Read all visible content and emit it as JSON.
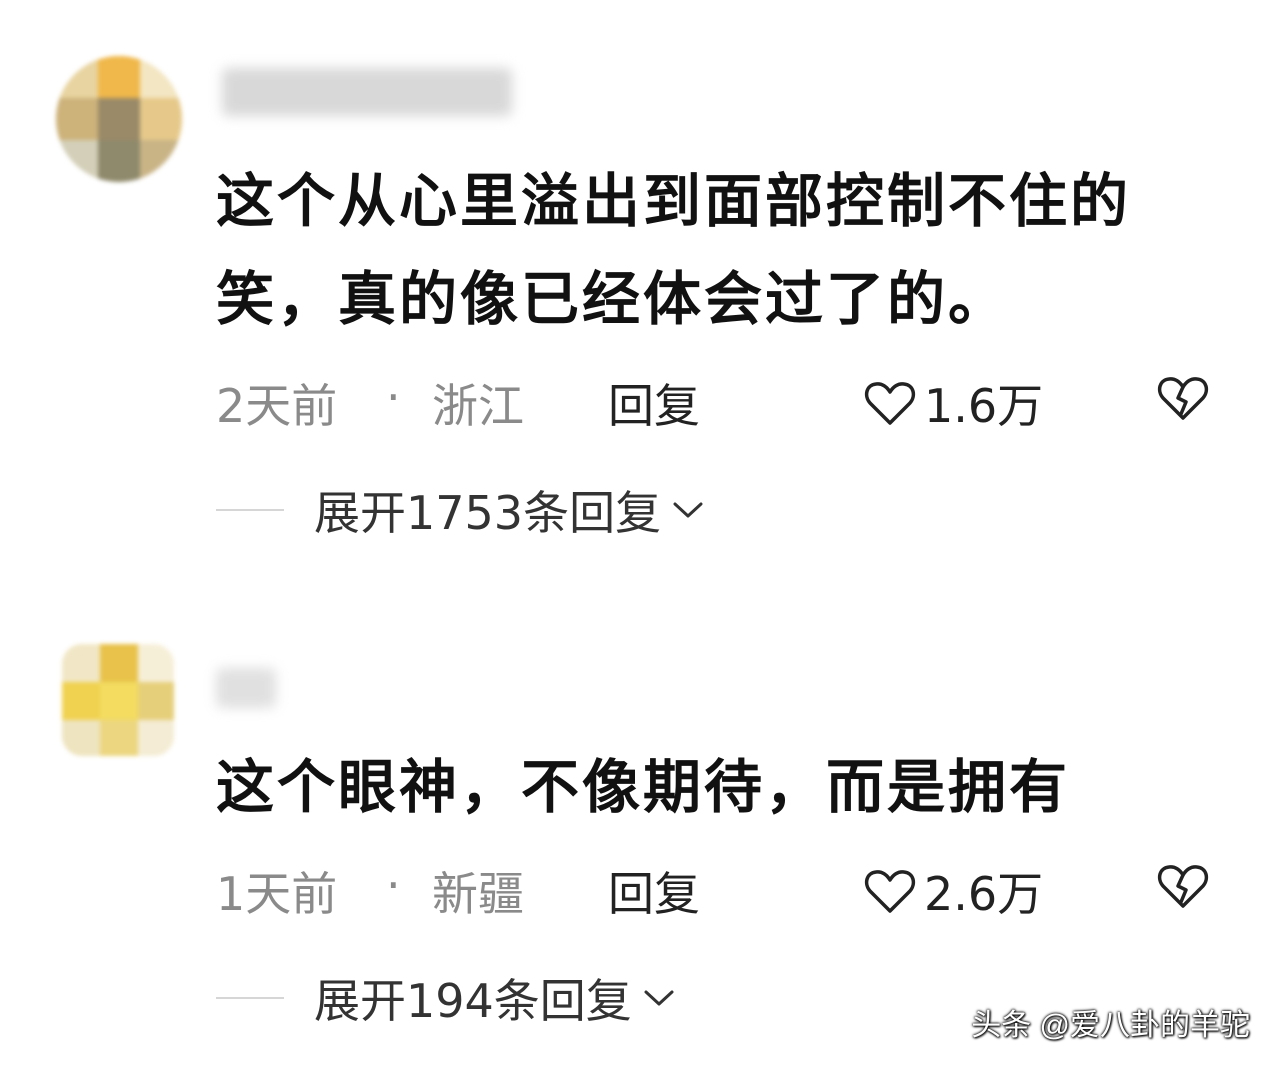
{
  "comments": [
    {
      "text": "这个从心里溢出到面部控制不住的笑，真的像已经体会过了的。",
      "time": "2天前",
      "separator": "·",
      "location": "浙江",
      "reply_label": "回复",
      "likes": "1.6万",
      "expand_label": "展开1753条回复"
    },
    {
      "text": "这个眼神，不像期待，而是拥有",
      "time": "1天前",
      "separator": "·",
      "location": "新疆",
      "reply_label": "回复",
      "likes": "2.6万",
      "expand_label": "展开194条回复"
    }
  ],
  "icons": {
    "like": "heart-outline-icon",
    "dislike": "broken-heart-icon",
    "expand": "chevron-down-icon"
  },
  "colors": {
    "text": "#111111",
    "meta": "#8a8a8a",
    "watermark": "#ffffff"
  },
  "watermark": "头条 @爱八卦的羊驼"
}
